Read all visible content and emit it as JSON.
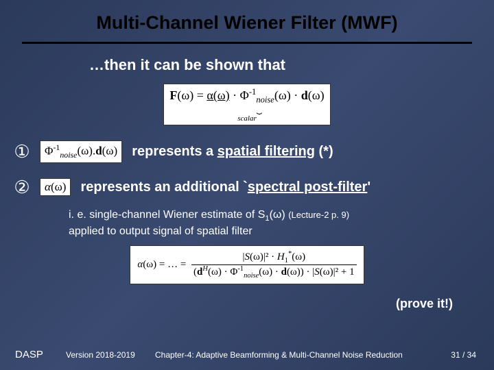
{
  "title": "Multi-Channel Wiener Filter (MWF)",
  "intro": "…then it can be shown that",
  "eq_main": "F(ω) = α(ω) · Φ⁻¹_noise(ω) · d(ω)",
  "eq_main_scalar": "scalar",
  "bullets": {
    "b1": {
      "num": "①",
      "formula": "Φ⁻¹_noise(ω) · d(ω)",
      "text_pre": "represents a  ",
      "text_ul": "spatial filtering",
      "text_post": "  (*)"
    },
    "b2": {
      "num": "②",
      "formula": "α(ω)",
      "text_pre": "represents an additional `",
      "text_ul": "spectral post-filter",
      "text_post": "'"
    }
  },
  "subnote_line1_a": "i. e. single-channel Wiener estimate of S",
  "subnote_line1_sub": "1",
  "subnote_line1_b": "(ω) ",
  "subnote_lecref": "(Lecture-2 p. 9)",
  "subnote_line2": "applied to output signal of spatial filter",
  "eq_alpha_lhs": "α(ω) = … =",
  "eq_alpha_num": "|S(ω)|² · H₁*(ω)",
  "eq_alpha_den": "(dᴴ(ω) · Φ⁻¹_noise(ω) · d(ω)) · |S(ω)|² + 1",
  "prove": "(prove it!)",
  "footer": {
    "dasp": "DASP",
    "version": "Version 2018-2019",
    "chapter": "Chapter-4: Adaptive Beamforming & Multi-Channel Noise Reduction",
    "page": "31 / 34"
  }
}
